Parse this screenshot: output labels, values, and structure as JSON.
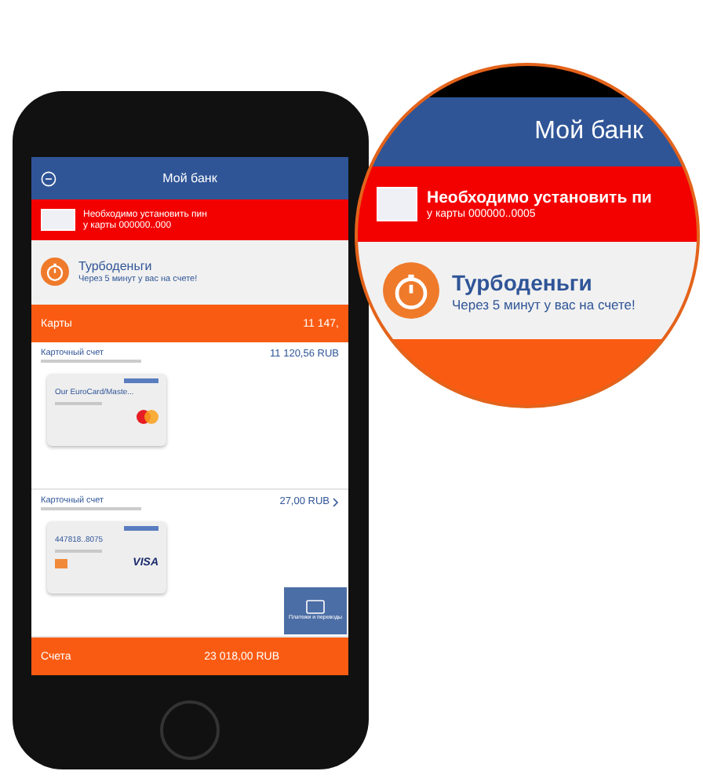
{
  "phone": {
    "header": {
      "title": "Мой банк"
    },
    "alert": {
      "title": "Необходимо установить пин",
      "subtitle": "у карты 000000..000"
    },
    "promo": {
      "title": "Турбоденьги",
      "subtitle": "Через 5 минут у вас на счете!"
    },
    "cards_section": {
      "title": "Карты",
      "total": "11 147,"
    },
    "accounts": [
      {
        "label": "Карточный счет",
        "amount": "11 120,56 RUB",
        "chevron": false,
        "card": {
          "name": "Our EuroCard/Maste...",
          "kind": "mastercard"
        }
      },
      {
        "label": "Карточный счет",
        "amount": "27,00 RUB",
        "chevron": true,
        "card": {
          "name": "447818..8075",
          "kind": "visa",
          "network_label": "VISA"
        }
      }
    ],
    "accounts_section": {
      "title": "Счета",
      "total": "23 018,00 RUB"
    },
    "fab": {
      "label": "Платежи и переводы"
    }
  },
  "magnifier": {
    "header": {
      "title": "Мой банк"
    },
    "alert": {
      "title": "Необходимо установить пи",
      "subtitle": "у карты 000000..0005"
    },
    "promo": {
      "title": "Турбоденьги",
      "subtitle": "Через 5 минут у вас на счете!"
    }
  }
}
